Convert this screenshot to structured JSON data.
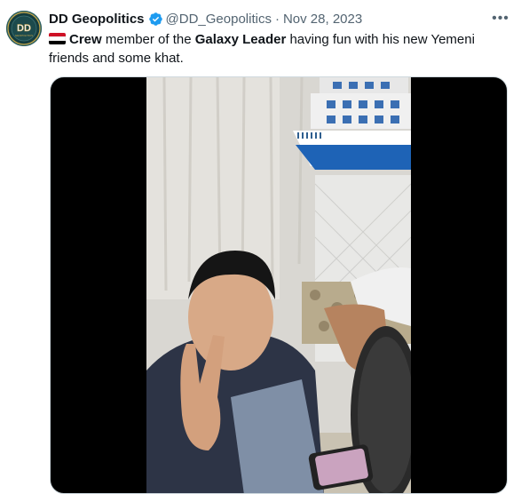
{
  "author": {
    "display_name": "DD Geopolitics",
    "handle": "@DD_Geopolitics",
    "separator": "·",
    "date": "Nov 28, 2023",
    "avatar_text": "DD",
    "avatar_subtext": "GEOPOLITICS"
  },
  "tweet": {
    "flag_emoji": "yemen-flag",
    "bold1": "Crew",
    "text1": " member of the ",
    "bold2": "Galaxy Leader",
    "text2": " having fun with his new Yemeni friends and some khat."
  },
  "menu": {
    "more_label": "•••"
  },
  "colors": {
    "verified": "#1d9bf0",
    "secondary_text": "#536471",
    "flag_red": "#ce1126",
    "flag_white": "#ffffff",
    "flag_black": "#000000",
    "ship_blue": "#1e63b6"
  }
}
